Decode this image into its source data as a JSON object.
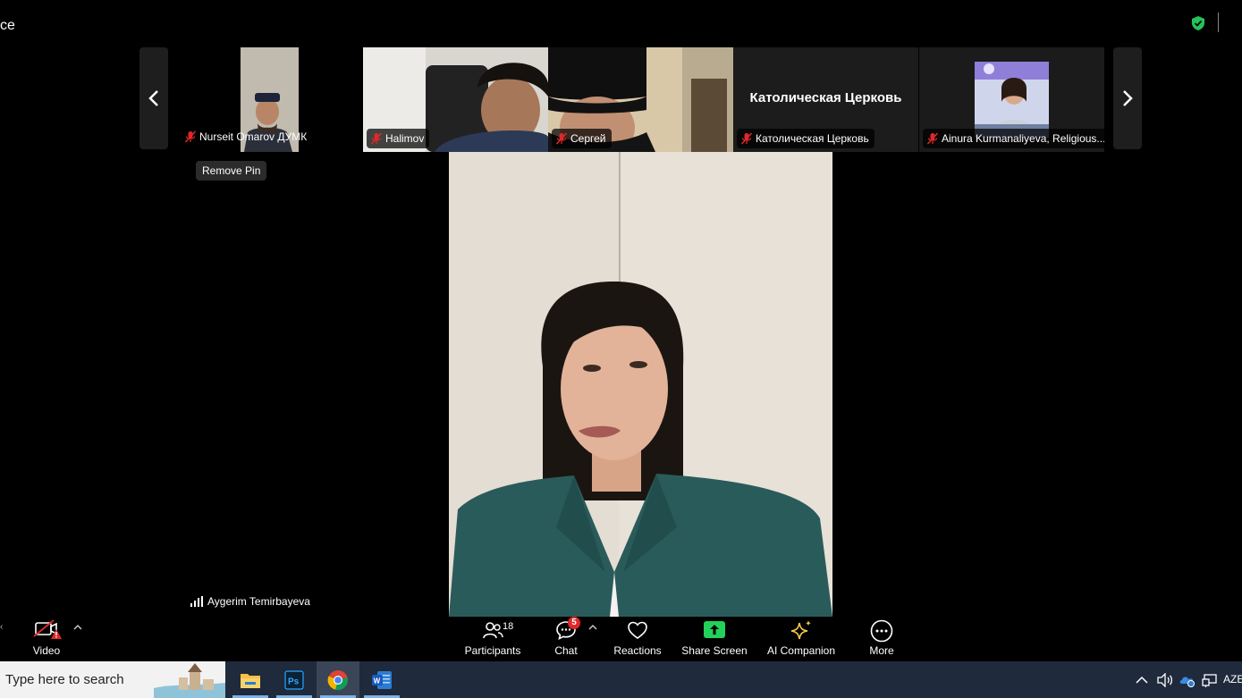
{
  "window": {
    "title_fragment": "ce"
  },
  "gallery": {
    "tiles": [
      {
        "name": "Nurseit Omarov ДУМК"
      },
      {
        "name": "Halimov"
      },
      {
        "name": "Сергей"
      },
      {
        "name": "Католическая Церковь",
        "big_label": "Католическая Церковь"
      },
      {
        "name": "Ainura Kurmanaliyeva, Religious..."
      }
    ],
    "remove_pin_label": "Remove Pin"
  },
  "speaker": {
    "name": "Aygerim Temirbayeva"
  },
  "toolbar": {
    "video_label": "Video",
    "participants_label": "Participants",
    "participants_count": "18",
    "chat_label": "Chat",
    "chat_badge": "5",
    "reactions_label": "Reactions",
    "share_label": "Share Screen",
    "ai_label": "AI Companion",
    "more_label": "More",
    "colors": {
      "share_green": "#23d15a",
      "ai_yellow": "#f6c94a",
      "alert_red": "#e02828"
    }
  },
  "taskbar": {
    "search_placeholder": "Type here to search",
    "apps": [
      "file-explorer-icon",
      "photoshop-icon",
      "chrome-icon",
      "word-icon"
    ],
    "language": "AZE"
  }
}
